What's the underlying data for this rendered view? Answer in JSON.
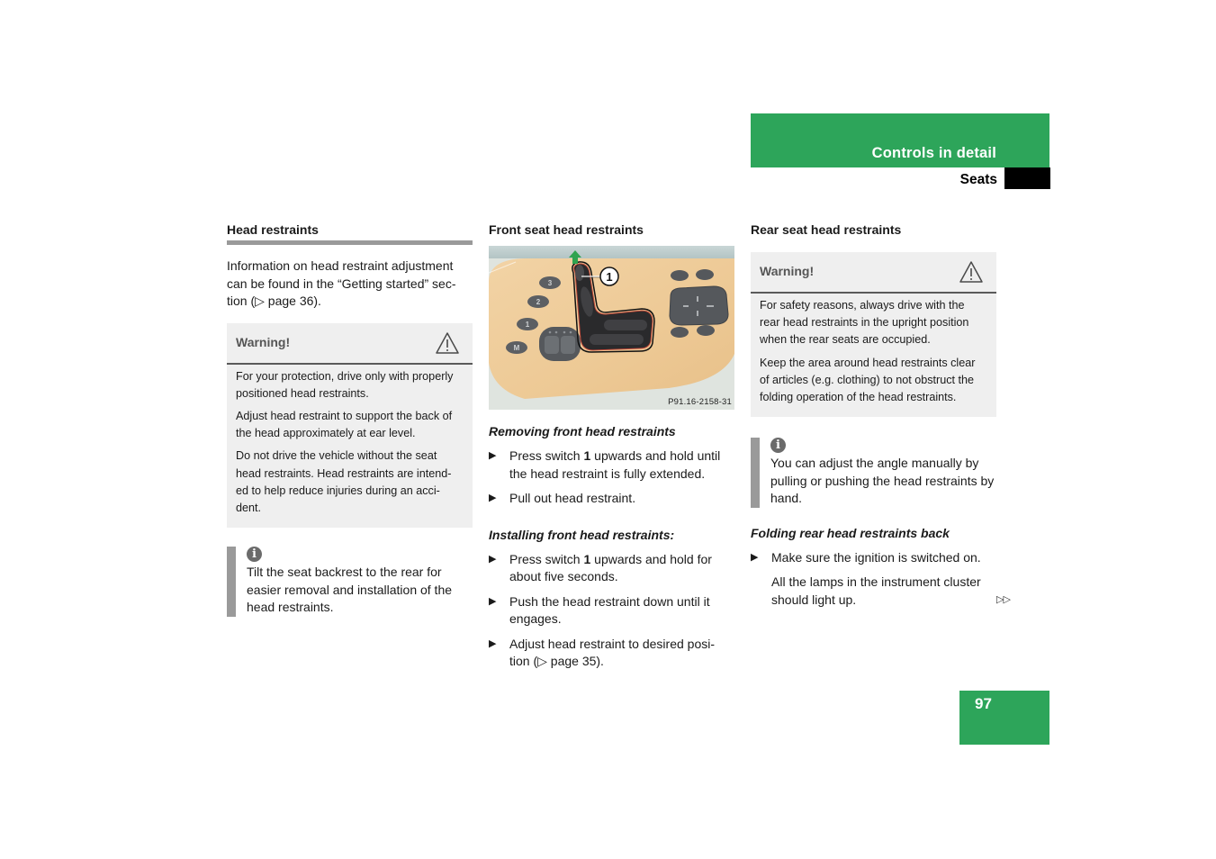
{
  "header": {
    "section_title": "Controls in detail",
    "subsection_title": "Seats",
    "brand_color": "#2da55a"
  },
  "column1": {
    "heading": "Head restraints",
    "intro": "Information on head restraint adjustment can be found in the “Getting started” sec-tion (▷ page 36).",
    "warning": {
      "label": "Warning!",
      "icon": "warning-triangle-icon",
      "paragraphs": [
        "For your protection, drive only with properly positioned head restraints.",
        "Adjust head restraint to support the back of the head approximately at ear level.",
        "Do not drive the vehicle without the seat head restraints. Head restraints are intend-ed to help reduce injuries during an acci-dent."
      ]
    },
    "note": {
      "icon": "info-icon",
      "icon_glyph": "i",
      "text": "Tilt the seat backrest to the rear for easier removal and installation of the head restraints."
    }
  },
  "column2": {
    "heading": "Front seat head restraints",
    "figure": {
      "code": "P91.16-2158-31",
      "callout": "1",
      "memory_buttons": [
        "3",
        "2",
        "1",
        "M"
      ]
    },
    "removing": {
      "title": "Removing front head restraints",
      "steps": [
        {
          "pre": "Press switch ",
          "bold": "1",
          "post": " upwards and hold until the head restraint is fully extended."
        },
        {
          "pre": "Pull out head restraint.",
          "bold": "",
          "post": ""
        }
      ]
    },
    "installing": {
      "title": "Installing front head restraints:",
      "steps": [
        {
          "pre": "Press switch ",
          "bold": "1",
          "post": " upwards and hold for about five seconds."
        },
        {
          "pre": "Push the head restraint down until it engages.",
          "bold": "",
          "post": ""
        },
        {
          "pre": "Adjust head restraint to desired posi-tion (▷ page 35).",
          "bold": "",
          "post": ""
        }
      ]
    },
    "bullet_glyph": "▶"
  },
  "column3": {
    "heading": "Rear seat head restraints",
    "warning": {
      "label": "Warning!",
      "icon": "warning-triangle-icon",
      "paragraphs": [
        "For safety reasons, always drive with the rear head restraints in the upright position when the rear seats are occupied.",
        "Keep the area around head restraints clear of articles (e.g. clothing) to not obstruct the folding operation of the head restraints."
      ]
    },
    "note": {
      "icon": "info-icon",
      "icon_glyph": "i",
      "text": "You can adjust the angle manually by pulling or pushing the head restraints by hand."
    },
    "folding": {
      "title": "Folding rear head restraints back",
      "steps": [
        {
          "pre": "Make sure the ignition is switched on.",
          "bold": "",
          "post": ""
        }
      ],
      "result": "All the lamps in the instrument cluster should light up."
    },
    "continued_marker": "▷▷"
  },
  "footer": {
    "page_number": "97"
  }
}
